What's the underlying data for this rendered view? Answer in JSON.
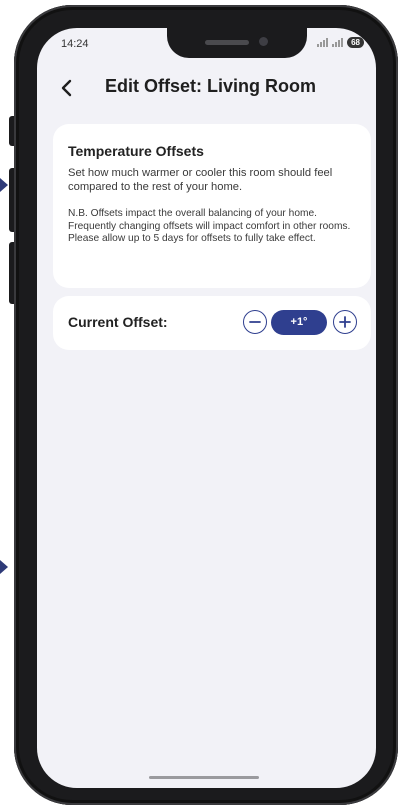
{
  "status_bar": {
    "time": "14:24",
    "battery": "68"
  },
  "header": {
    "back_icon": "chevron-left-icon",
    "title": "Edit Offset: Living Room"
  },
  "info_card": {
    "title": "Temperature Offsets",
    "description": "Set how much warmer or cooler this room should feel compared to the rest of your home.",
    "note": "N.B. Offsets impact the overall balancing of your home. Frequently changing offsets will impact comfort in other rooms. Please allow up to 5 days for offsets to fully take effect."
  },
  "offset_card": {
    "label": "Current Offset:",
    "value": "+1°",
    "decrement_icon": "minus-icon",
    "increment_icon": "plus-icon"
  },
  "colors": {
    "accent": "#2f3f8f",
    "screen_background": "#f2f2f7",
    "card_background": "#ffffff"
  }
}
